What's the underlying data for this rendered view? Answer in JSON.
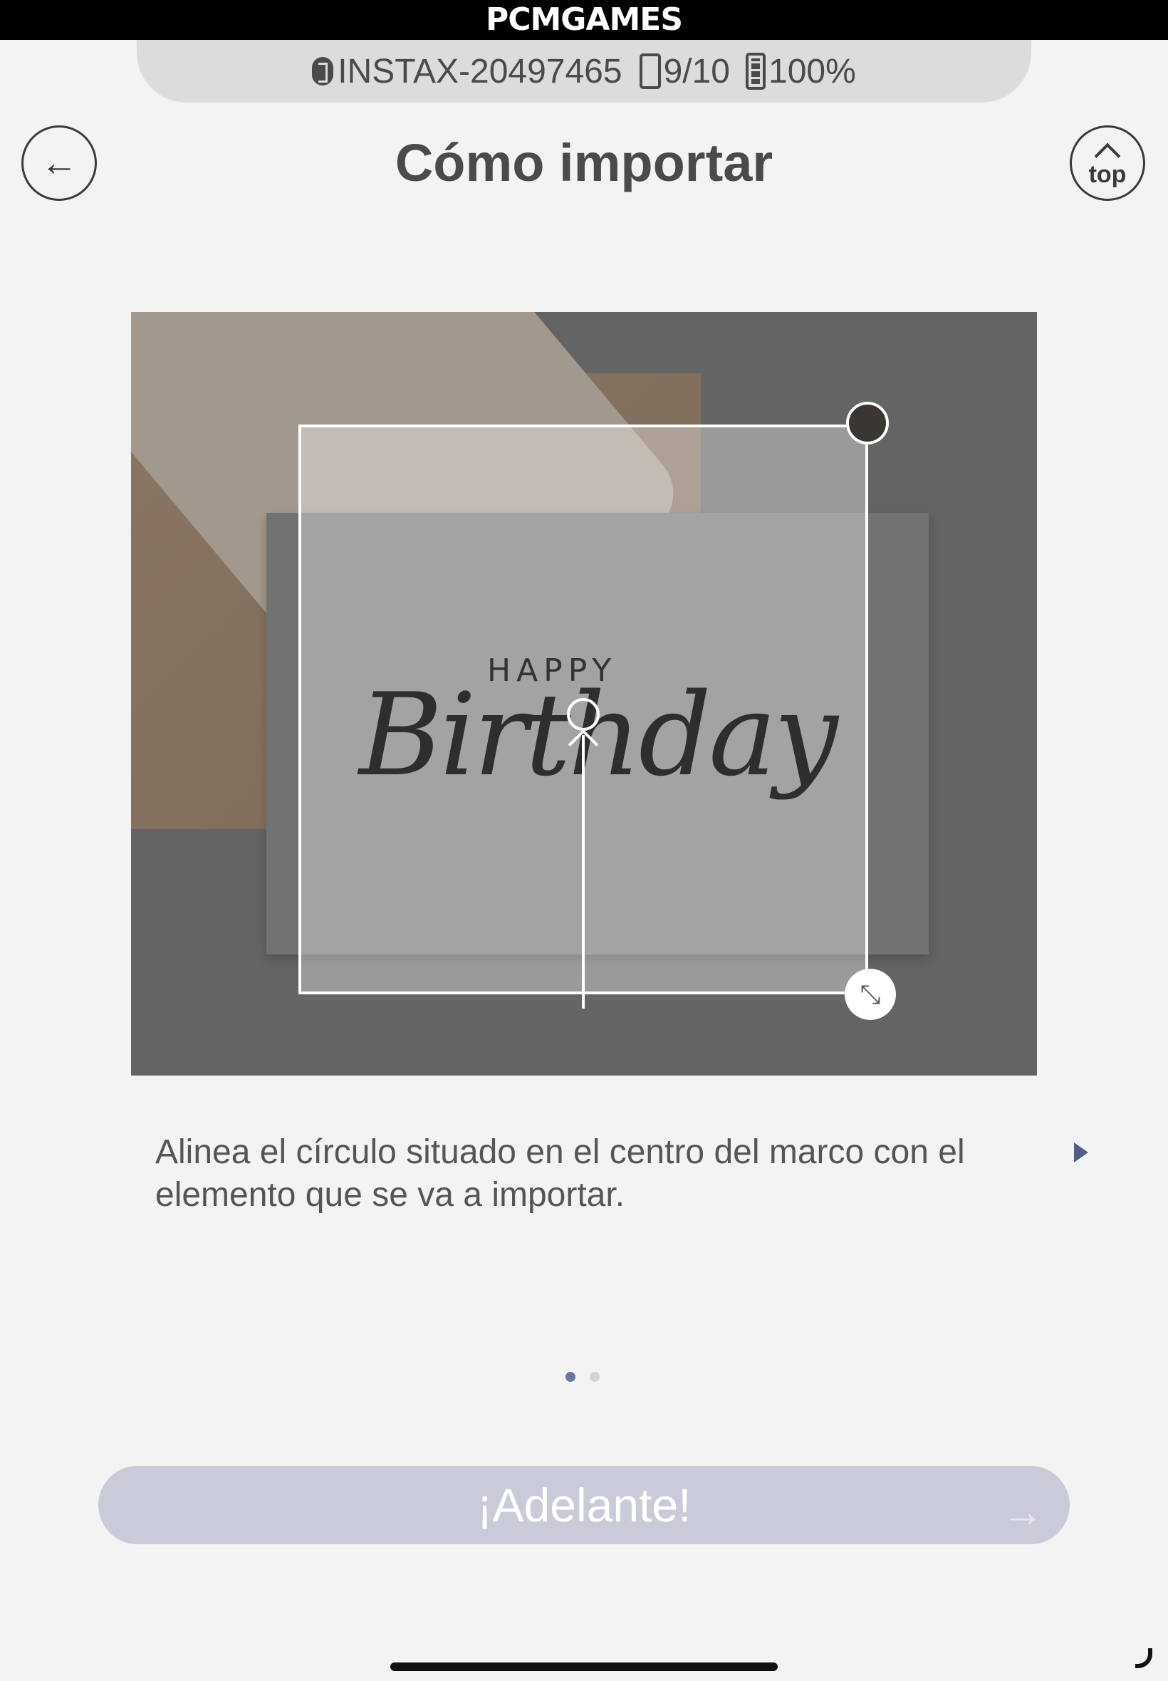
{
  "watermark": {
    "text": "PCMGAMES"
  },
  "device_status": {
    "device_name": "INSTAX-20497465",
    "film_count": "9/10",
    "battery": "100%"
  },
  "header": {
    "title": "Cómo importar",
    "back_symbol": "←",
    "top_label": "top"
  },
  "illustration": {
    "card_small_text": "HAPPY",
    "card_script_text": "Birthday",
    "resize_symbol": "⤡"
  },
  "instructions": {
    "text": "Alinea el círculo situado en el centro del marco con el elemento que se va a importar."
  },
  "pagination": {
    "current": 1,
    "total": 2
  },
  "cta": {
    "label": "¡Adelante!",
    "arrow": "→"
  },
  "colors": {
    "accent": "#6b77a3",
    "cta_background": "#c9cbd8",
    "background": "#f3f3f3"
  }
}
